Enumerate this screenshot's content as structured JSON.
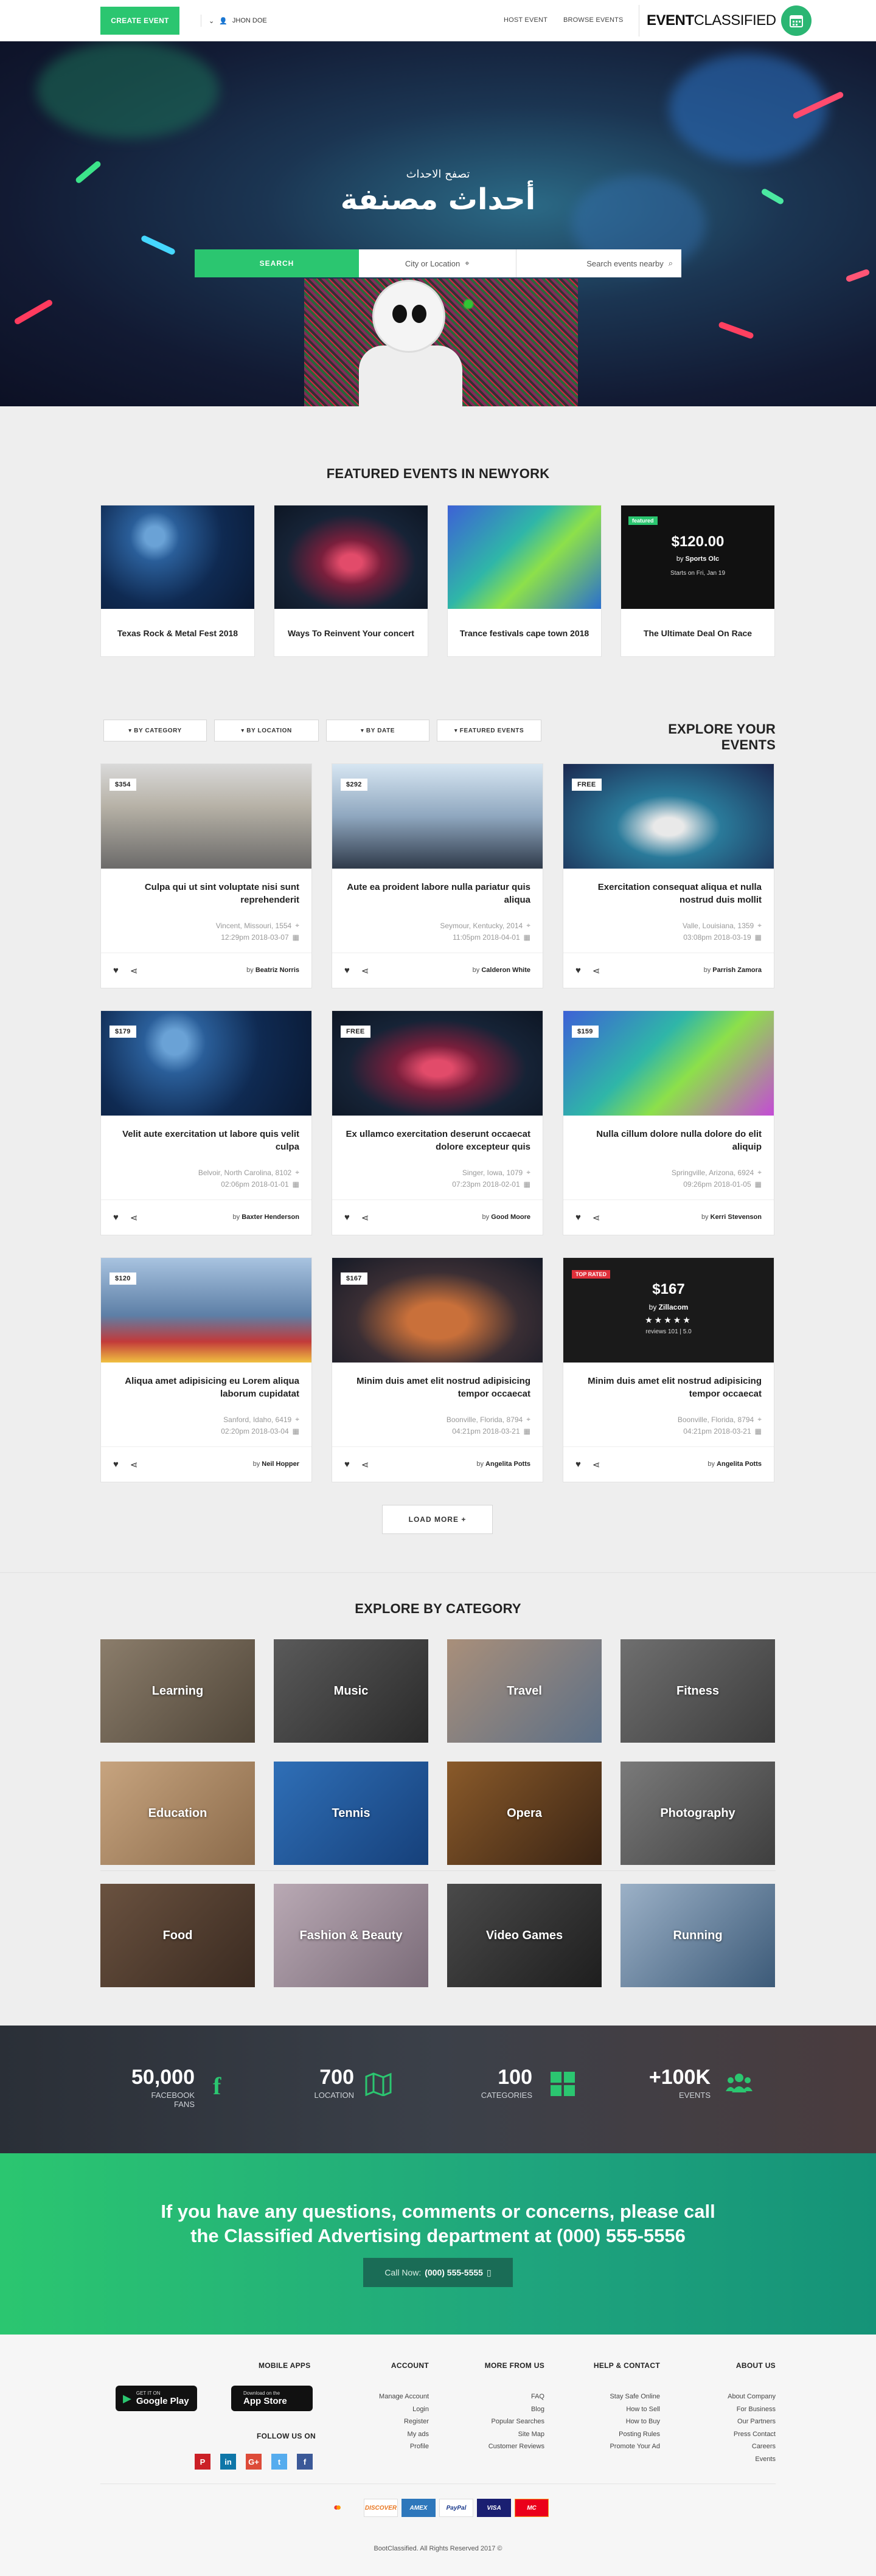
{
  "header": {
    "create_label": "CREATE EVENT",
    "user_name": "JHON DOE",
    "nav": [
      "HOST EVENT",
      "BROWSE EVENTS"
    ],
    "logo_bold": "EVENT",
    "logo_light": "CLASSIFIED"
  },
  "hero": {
    "subtitle": "تصفح الاحداث",
    "title": "أحداث مصنفة",
    "search_button": "SEARCH",
    "location_placeholder": "City or Location",
    "events_placeholder": "Search events nearby"
  },
  "featured": {
    "title": "FEATURED EVENTS IN NEWYORK",
    "items": [
      {
        "title": "Texas Rock & Metal Fest 2018"
      },
      {
        "title": "Ways To Reinvent Your concert"
      },
      {
        "title": "Trance festivals cape town 2018"
      },
      {
        "title": "The Ultimate Deal On Race",
        "badge": "featured",
        "price": "$120.00",
        "by_prefix": "by",
        "by": "Sports Olc",
        "starts": "Starts on Fri, Jan 19"
      }
    ]
  },
  "explore": {
    "title": "EXPLORE YOUR EVENTS",
    "filters": [
      "BY CATEGORY",
      "BY LOCATION",
      "BY DATE",
      "FEATURED EVENTS"
    ],
    "load_more": "LOAD MORE",
    "events": [
      {
        "price": "$354",
        "title": "Culpa qui ut sint voluptate nisi sunt reprehenderit",
        "location": "Vincent, Missouri, 1554",
        "datetime": "12:29pm 2018-03-07",
        "by_prefix": "by",
        "by": "Beatriz Norris"
      },
      {
        "price": "$292",
        "title": "Aute ea proident labore nulla pariatur quis aliqua",
        "location": "Seymour, Kentucky, 2014",
        "datetime": "11:05pm 2018-04-01",
        "by_prefix": "by",
        "by": "Calderon White"
      },
      {
        "price": "FREE",
        "title": "Exercitation consequat aliqua et nulla nostrud duis mollit",
        "location": "Valle, Louisiana, 1359",
        "datetime": "03:08pm 2018-03-19",
        "by_prefix": "by",
        "by": "Parrish Zamora"
      },
      {
        "price": "$179",
        "title": "Velit aute exercitation ut labore quis velit culpa",
        "location": "Belvoir, North Carolina, 8102",
        "datetime": "02:06pm 2018-01-01",
        "by_prefix": "by",
        "by": "Baxter Henderson"
      },
      {
        "price": "FREE",
        "title": "Ex ullamco exercitation deserunt occaecat dolore excepteur quis",
        "location": "Singer, Iowa, 1079",
        "datetime": "07:23pm 2018-02-01",
        "by_prefix": "by",
        "by": "Good Moore"
      },
      {
        "price": "$159",
        "title": "Nulla cillum dolore nulla dolore do elit aliquip",
        "location": "Springville, Arizona, 6924",
        "datetime": "09:26pm 2018-01-05",
        "by_prefix": "by",
        "by": "Kerri Stevenson"
      },
      {
        "price": "$120",
        "title": "Aliqua amet adipisicing eu Lorem aliqua laborum cupidatat",
        "location": "Sanford, Idaho, 6419",
        "datetime": "02:20pm 2018-03-04",
        "by_prefix": "by",
        "by": "Neil Hopper"
      },
      {
        "price": "$167",
        "title": "Minim duis amet elit nostrud adipisicing tempor occaecat",
        "location": "Boonville, Florida, 8794",
        "datetime": "04:21pm 2018-03-21",
        "by_prefix": "by",
        "by": "Angelita Potts"
      },
      {
        "price": "",
        "badge": "TOP RATED",
        "overlay_price": "$167",
        "overlay_by_prefix": "by",
        "overlay_by": "Zillacom",
        "reviews": "reviews 101 | 5.0",
        "rating": 5,
        "title": "Minim duis amet elit nostrud adipisicing tempor occaecat",
        "location": "Boonville, Florida, 8794",
        "datetime": "04:21pm 2018-03-21",
        "by_prefix": "by",
        "by": "Angelita Potts"
      }
    ]
  },
  "categories": {
    "title": "EXPLORE BY CATEGORY",
    "items": [
      "Learning",
      "Music",
      "Travel",
      "Fitness",
      "Education",
      "Tennis",
      "Opera",
      "Photography",
      "Food",
      "Fashion & Beauty",
      "Video Games",
      "Running"
    ]
  },
  "stats": [
    {
      "number": "50,000",
      "label": "FACEBOOK FANS",
      "icon": "facebook-icon"
    },
    {
      "number": "700",
      "label": "LOCATION",
      "icon": "map-icon"
    },
    {
      "number": "100",
      "label": "CATEGORIES",
      "icon": "grid-icon"
    },
    {
      "number": "+100K",
      "label": "EVENTS",
      "icon": "users-icon"
    }
  ],
  "cta": {
    "line1": "If you have any questions, comments or concerns, please call",
    "line2": "the Classified Advertising department at (000) 555-5556",
    "call_prefix": "Call Now:",
    "call_number": "(000) 555-5555"
  },
  "footer": {
    "mobile_apps": "MOBILE APPS",
    "google_small": "GET IT ON",
    "google_big": "Google Play",
    "apple_small": "Download on the",
    "apple_big": "App Store",
    "follow": "FOLLOW US ON",
    "social": [
      "P",
      "in",
      "G+",
      "t",
      "f"
    ],
    "columns": [
      {
        "title": "ACCOUNT",
        "links": [
          "Manage Account",
          "Login",
          "Register",
          "My ads",
          "Profile"
        ]
      },
      {
        "title": "MORE FROM US",
        "links": [
          "FAQ",
          "Blog",
          "Popular Searches",
          "Site Map",
          "Customer Reviews"
        ]
      },
      {
        "title": "HELP & CONTACT",
        "links": [
          "Stay Safe Online",
          "How to Sell",
          "How to Buy",
          "Posting Rules",
          "Promote Your Ad"
        ]
      },
      {
        "title": "ABOUT US",
        "links": [
          "About Company",
          "For Business",
          "Our Partners",
          "Press Contact",
          "Careers",
          "Events"
        ]
      }
    ],
    "payments": [
      "DISCOVER",
      "AMEX",
      "PayPal",
      "VISA",
      "MC"
    ],
    "copyright": "BootClassified. All Rights Reserved 2017 ©"
  },
  "colors": {
    "accent": "#2bc670",
    "dark": "#2a2f37",
    "cta_end": "#159378"
  }
}
